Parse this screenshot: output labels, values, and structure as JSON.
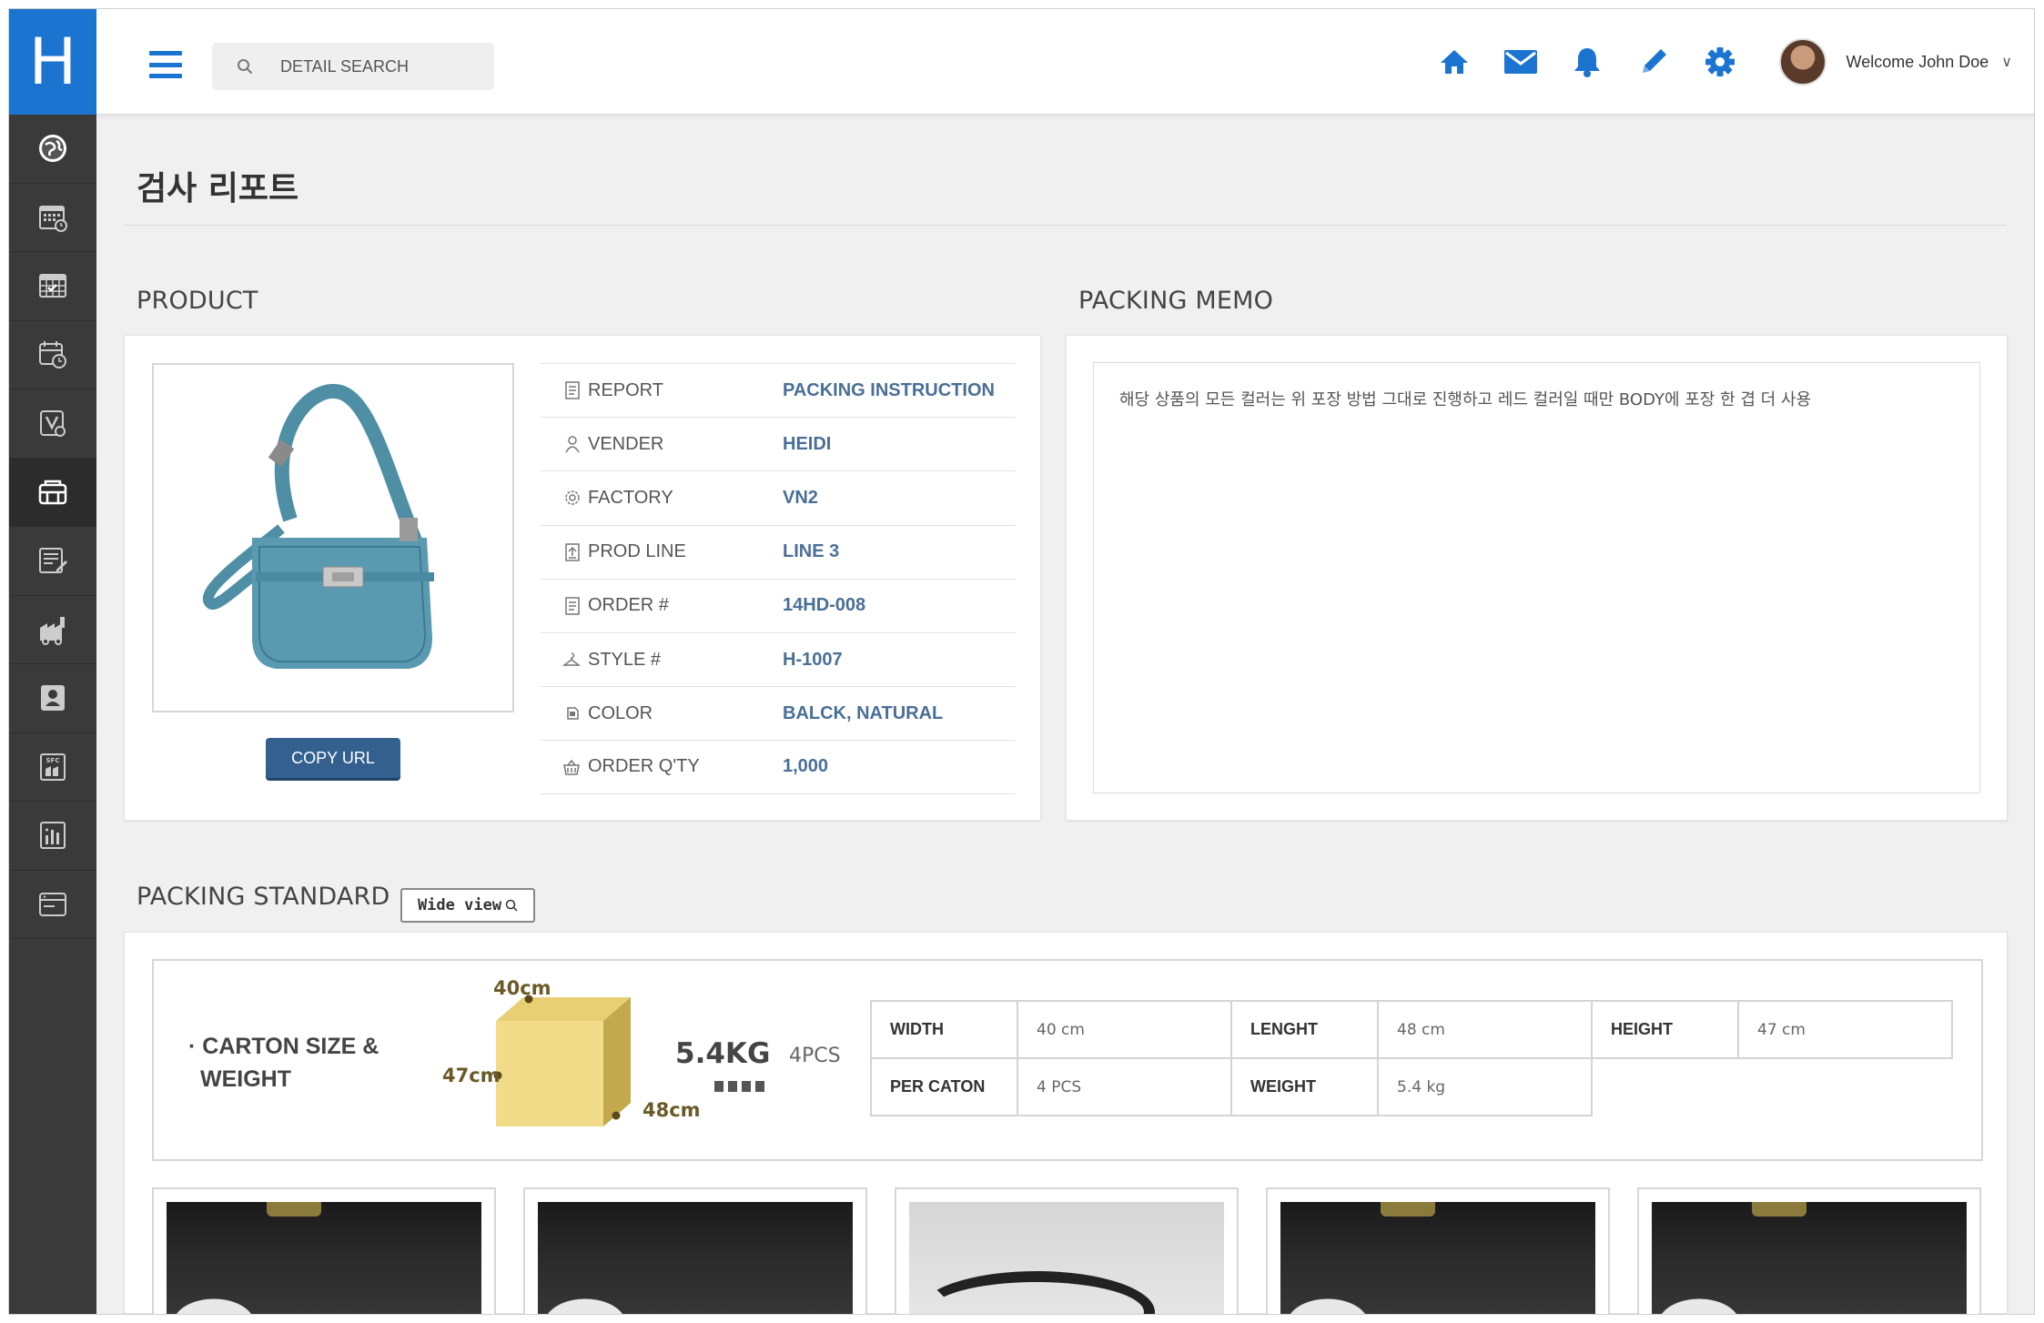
{
  "app": {
    "logo_letter": "H"
  },
  "sidebar": {
    "items": [
      {
        "icon": "globe-icon"
      },
      {
        "icon": "calendar-icon"
      },
      {
        "icon": "schedule-icon"
      },
      {
        "icon": "calendar-clock-icon"
      },
      {
        "icon": "inspection-icon"
      },
      {
        "icon": "packing-icon",
        "active": true
      },
      {
        "icon": "report-edit-icon"
      },
      {
        "icon": "factory-icon"
      },
      {
        "icon": "id-card-icon"
      },
      {
        "icon": "sfc-icon"
      },
      {
        "icon": "statistics-icon"
      },
      {
        "icon": "window-icon"
      }
    ]
  },
  "topbar": {
    "search_placeholder": "DETAIL SEARCH",
    "icons": [
      "home-icon",
      "mail-icon",
      "bell-icon",
      "pencil-icon",
      "gear-icon"
    ],
    "welcome": "Welcome John Doe",
    "chevron": "∨"
  },
  "page": {
    "title": "검사 리포트"
  },
  "product": {
    "section_title": "PRODUCT",
    "copy_url_label": "COPY URL",
    "rows": [
      {
        "icon": "document-icon",
        "label": "REPORT",
        "value": "PACKING INSTRUCTION"
      },
      {
        "icon": "person-icon",
        "label": "VENDER",
        "value": "HEIDI"
      },
      {
        "icon": "gear-small-icon",
        "label": "FACTORY",
        "value": "VN2"
      },
      {
        "icon": "upload-doc-icon",
        "label": "PROD LINE",
        "value": "LINE 3"
      },
      {
        "icon": "document-icon",
        "label": "ORDER #",
        "value": "14HD-008"
      },
      {
        "icon": "hanger-icon",
        "label": "STYLE #",
        "value": "H-1007"
      },
      {
        "icon": "palette-icon",
        "label": "COLOR",
        "value": "BALCK, NATURAL"
      },
      {
        "icon": "basket-icon",
        "label": "ORDER Q'TY",
        "value": "1,000"
      }
    ]
  },
  "packing_memo": {
    "section_title": "PACKING MEMO",
    "text": "해당 상품의 모든 컬러는 위 포장 방법 그대로 진행하고 레드 컬러일 때만 BODY에 포장 한 겹 더 사용"
  },
  "packing_standard": {
    "section_title": "PACKING STANDARD",
    "wide_view_label": "Wide view",
    "carton_label_line1": "· CARTON SIZE &",
    "carton_label_line2": "WEIGHT",
    "dim_top": "40cm",
    "dim_left": "47cm",
    "dim_right": "48cm",
    "weight_big": "5.4KG",
    "weight_pcs": "4PCS",
    "box_color": "#f0d98a",
    "specs": {
      "width_label": "WIDTH",
      "width_value": "40 cm",
      "length_label": "LENGHT",
      "length_value": "48 cm",
      "height_label": "HEIGHT",
      "height_value": "47 cm",
      "per_carton_label": "PER CATON",
      "per_carton_value": "4 PCS",
      "weight_label": "WEIGHT",
      "weight_value": "5.4 kg"
    }
  },
  "colors": {
    "accent": "#1b75d0",
    "sidebar": "#3a3a3a",
    "value_text": "#4a6f96",
    "button": "#33608f"
  }
}
